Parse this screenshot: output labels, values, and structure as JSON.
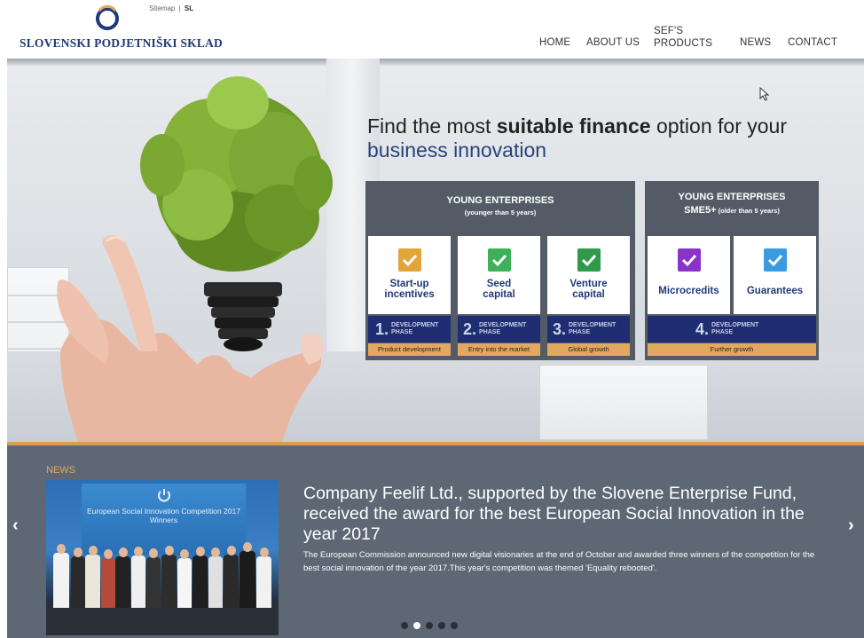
{
  "header": {
    "logo_text": "SLOVENSKI PODJETNIŠKI SKLAD",
    "sitemap": "Sitemap",
    "sitemap_sep": "|",
    "lang": "SL",
    "brand_color": "#1f3a78",
    "nav": {
      "home": "HOME",
      "about": "ABOUT US",
      "products_line1": "SEF'S",
      "products_line2": "PRODUCTS",
      "news": "NEWS",
      "contact": "CONTACT"
    }
  },
  "hero": {
    "title_part1": "Find the most ",
    "title_bold": "suitable finance",
    "title_part2": " option for your",
    "title_line2": "business innovation",
    "group1": {
      "title": "YOUNG ENTERPRISES",
      "subtitle": "(younger than 5 years)",
      "cards": [
        {
          "line1": "Start-up",
          "line2": "incentives",
          "check_color": "#e3a43a",
          "num": "1.",
          "phase1": "DEVELOPMENT",
          "phase2": "PHASE",
          "stage": "Product development"
        },
        {
          "line1": "Seed",
          "line2": "capital",
          "check_color": "#3fb05a",
          "num": "2.",
          "phase1": "DEVELOPMENT",
          "phase2": "PHASE",
          "stage": "Entry into the market"
        },
        {
          "line1": "Venture",
          "line2": "capital",
          "check_color": "#2e9a4a",
          "num": "3.",
          "phase1": "DEVELOPMENT",
          "phase2": "PHASE",
          "stage": "Global growth"
        }
      ]
    },
    "group2": {
      "title": "YOUNG ENTERPRISES",
      "subtitle_a": "SME5+",
      "subtitle_b": " (older than 5 years)",
      "cards": [
        {
          "label": "Microcredits",
          "check_color": "#8a33c9"
        },
        {
          "label": "Guarantees",
          "check_color": "#3a9be0"
        }
      ],
      "num": "4.",
      "phase1": "DEVELOPMENT",
      "phase2": "PHASE",
      "stage": "Further growth"
    }
  },
  "news": {
    "tag": "NEWS",
    "photo_caption": "European Social Innovation Competition 2017 Winners",
    "headline": "Company Feelif Ltd., supported by the Slovene Enterprise Fund, received the award for the best European Social Innovation in the year 2017",
    "body": "The European Commission announced new digital visionaries at the end of October and awarded three winners of the competition for the best social innovation of the year 2017.This year's competition was themed 'Equality rebooted'.",
    "prev": "‹",
    "next": "›",
    "dots_count": 5,
    "active_dot": 2
  }
}
